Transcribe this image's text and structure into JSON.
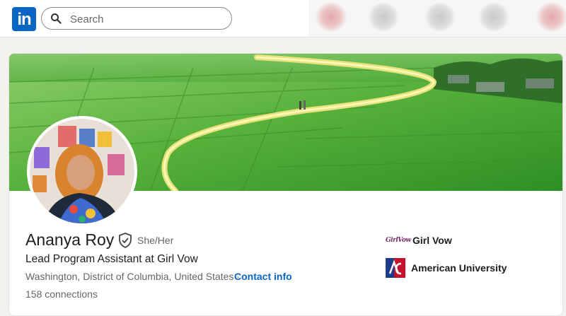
{
  "nav": {
    "logo_text": "in",
    "search_placeholder": "Search"
  },
  "profile": {
    "name": "Ananya Roy",
    "pronouns": "She/Her",
    "headline": "Lead Program Assistant at Girl Vow",
    "location": "Washington, District of Columbia, United States",
    "location_separator": "·",
    "contact_label": "Contact info",
    "connections": "158 connections"
  },
  "organizations": [
    {
      "name": "Girl Vow",
      "logo_text": "GirlVow"
    },
    {
      "name": "American University",
      "logo": "american-university-logo"
    }
  ],
  "colors": {
    "brand": "#0a66c2",
    "banner_green": "#3f9b2c",
    "au_red": "#c4122f"
  }
}
